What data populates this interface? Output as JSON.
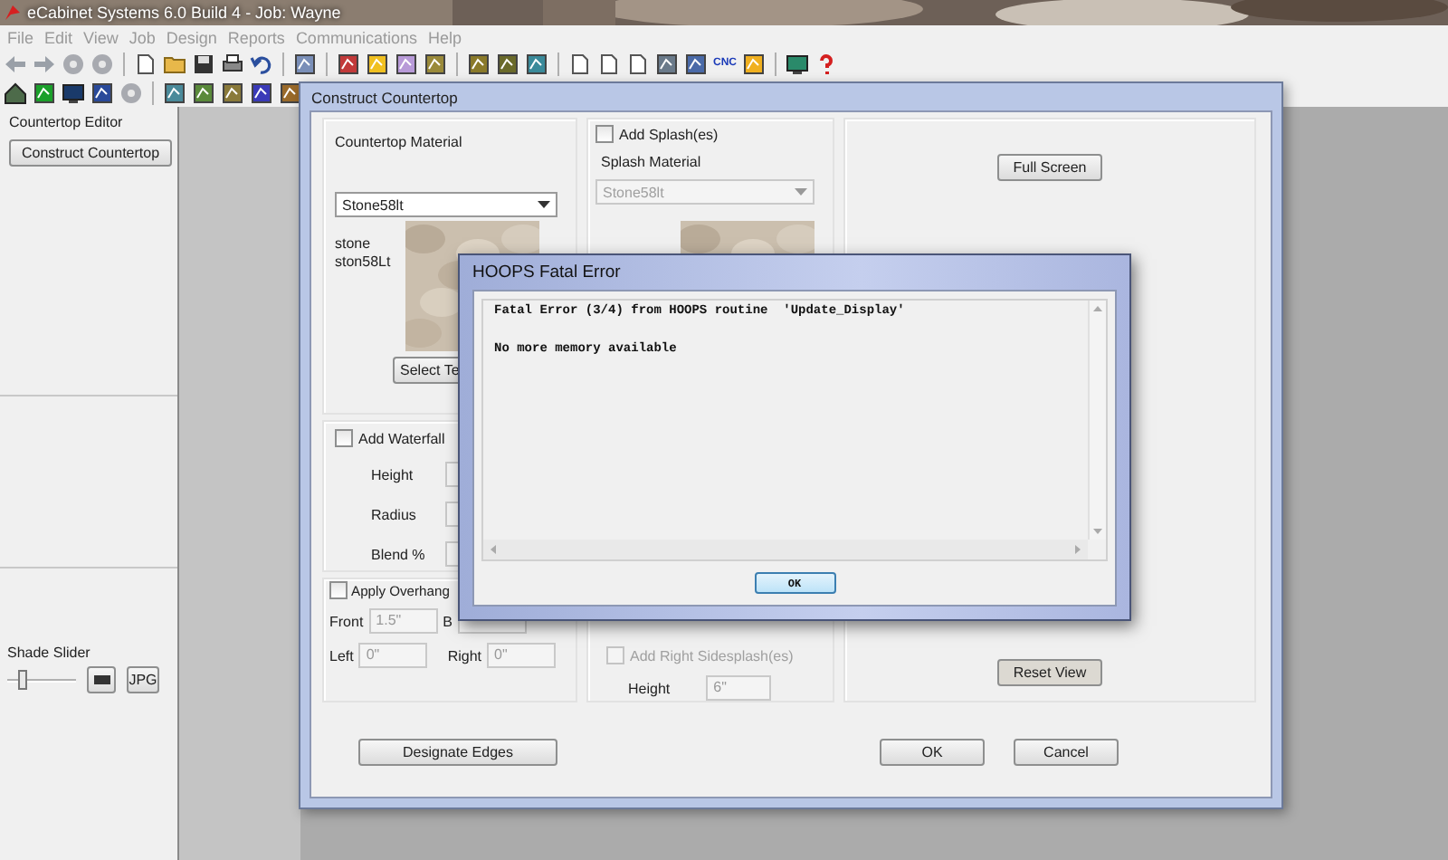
{
  "window": {
    "title": "eCabinet Systems 6.0 Build 4 - Job: Wayne"
  },
  "menu": [
    "File",
    "Edit",
    "View",
    "Job",
    "Design",
    "Reports",
    "Communications",
    "Help"
  ],
  "toolbar": {
    "cnc_label": "CNC"
  },
  "side_panel": {
    "title": "Countertop Editor",
    "construct_button": "Construct Countertop",
    "shade_label": "Shade Slider",
    "shade_slider": {
      "level": 0.2
    },
    "jpg_button": "JPG"
  },
  "countertop_dialog": {
    "title": "Construct Countertop",
    "material": {
      "label": "Countertop Material",
      "selection": "Stone58lt",
      "caption": [
        "stone",
        "ston58Lt"
      ],
      "select_button": "Select Te"
    },
    "waterfall": {
      "label": "Add Waterfall",
      "checked": false,
      "fields": [
        {
          "label": "Height",
          "disabled": true
        },
        {
          "label": "Radius",
          "disabled": true
        },
        {
          "label": "Blend %",
          "disabled": true
        }
      ]
    },
    "overhang": {
      "label": "Apply Overhang",
      "checked": false,
      "fields": [
        {
          "label": "Front",
          "value": "1.5\"",
          "disabled": true
        },
        {
          "label": "B",
          "disabled": true
        },
        {
          "label": "Left",
          "value": "0\"",
          "disabled": true
        },
        {
          "label": "Right",
          "value": "0\"",
          "disabled": true
        }
      ]
    },
    "splash": {
      "label": "Add Splash(es)",
      "checked": false,
      "material_label": "Splash Material",
      "selection": "Stone58lt",
      "disabled": true
    },
    "sidesplash": {
      "label": "Add Right Sidesplash(es)",
      "checked": false,
      "disabled": true,
      "height_label": "Height",
      "height_value": "6\""
    },
    "full_screen_button": "Full Screen",
    "reset_view_button": "Reset View",
    "designate_button": "Designate Edges",
    "ok_button": "OK",
    "cancel_button": "Cancel"
  },
  "error_dialog": {
    "title": "HOOPS Fatal Error",
    "lines": [
      "Fatal Error (3/4) from HOOPS routine  'Update_Display'",
      "No more memory available"
    ],
    "ok_button": "OK"
  }
}
